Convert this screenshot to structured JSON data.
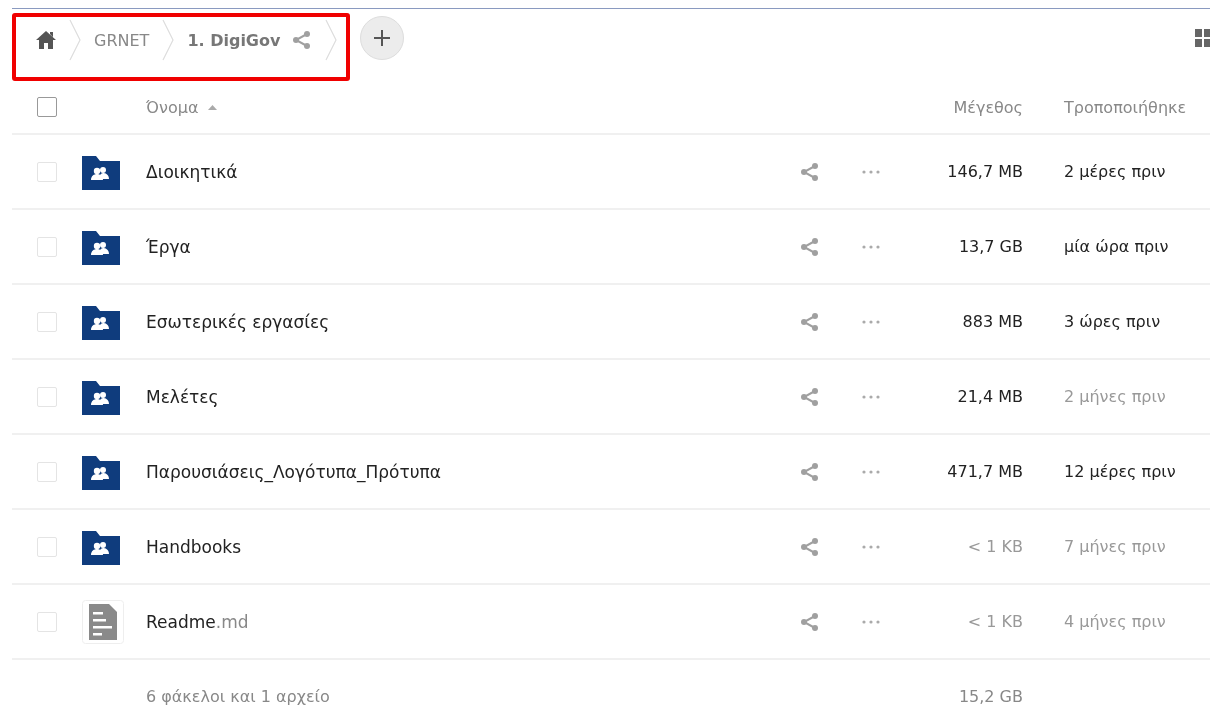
{
  "breadcrumb": {
    "highlighted": true,
    "crumbs": [
      {
        "label": "GRNET",
        "current": false
      },
      {
        "label": "1. DigiGov",
        "current": true
      }
    ]
  },
  "header": {
    "name": "Όνομα",
    "size": "Μέγεθος",
    "modified": "Τροποποιήθηκε",
    "select_all": false
  },
  "rows": [
    {
      "kind": "folder",
      "name": "Διοικητικά",
      "size": "146,7 MB",
      "size_muted": false,
      "modified": "2 μέρες πριν",
      "modified_muted": false,
      "checked": false
    },
    {
      "kind": "folder",
      "name": "Έργα",
      "size": "13,7 GB",
      "size_muted": false,
      "modified": "μία ώρα πριν",
      "modified_muted": false,
      "checked": false
    },
    {
      "kind": "folder",
      "name": "Εσωτερικές εργασίες",
      "size": "883 MB",
      "size_muted": false,
      "modified": "3 ώρες πριν",
      "modified_muted": false,
      "checked": false
    },
    {
      "kind": "folder",
      "name": "Μελέτες",
      "size": "21,4 MB",
      "size_muted": false,
      "modified": "2 μήνες πριν",
      "modified_muted": true,
      "checked": false
    },
    {
      "kind": "folder",
      "name": "Παρουσιάσεις_Λογότυπα_Πρότυπα",
      "size": "471,7 MB",
      "size_muted": false,
      "modified": "12 μέρες πριν",
      "modified_muted": false,
      "checked": false
    },
    {
      "kind": "folder",
      "name": "Handbooks",
      "size": "< 1 KB",
      "size_muted": true,
      "modified": "7 μήνες πριν",
      "modified_muted": true,
      "checked": false
    },
    {
      "kind": "file",
      "name": "Readme",
      "extension": ".md",
      "size": "< 1 KB",
      "size_muted": true,
      "modified": "4 μήνες πριν",
      "modified_muted": true,
      "checked": false
    }
  ],
  "summary": {
    "text": "6 φάκελοι και 1 αρχείο",
    "size": "15,2 GB"
  }
}
